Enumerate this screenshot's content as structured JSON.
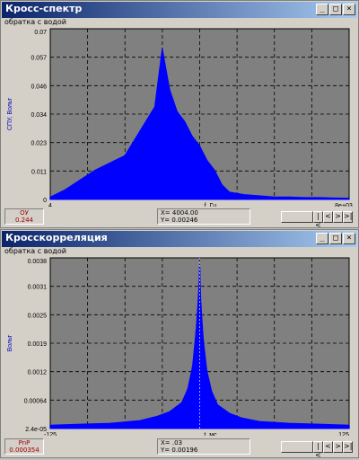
{
  "windows": [
    {
      "title": "Кросс-спектр",
      "subtitle": "обратка с водой",
      "footer_left": {
        "line1": "ОУ",
        "line2": "0.244"
      },
      "footer_mid": {
        "line1": "X= 4004.00",
        "line2": "Y= 0.00246"
      },
      "nav": {
        "first": "|<",
        "prev": "<",
        "next": ">",
        "last": ">|"
      }
    },
    {
      "title": "Кросскорреляция",
      "subtitle": "обратка с водой",
      "footer_left": {
        "line1": "PnP",
        "line2": "0.000354"
      },
      "footer_mid": {
        "line1": "X= .03",
        "line2": "Y= 0.00196"
      },
      "nav": {
        "first": "|<",
        "prev": "<",
        "next": ">",
        "last": ">|"
      }
    }
  ],
  "window_buttons": {
    "minimize": "_",
    "maximize": "□",
    "close": "×"
  },
  "chart_data": [
    {
      "type": "area",
      "title": "Кросс-спектр",
      "xlabel": "f, Гц",
      "ylabel": "СПУ, Вольт",
      "x_tick_labels": [
        "4",
        "8e+03"
      ],
      "y_tick_labels": [
        "0",
        "0.011",
        "0.023",
        "0.034",
        "0.046",
        "0.057",
        "0.07"
      ],
      "xlim": [
        4,
        8000
      ],
      "ylim": [
        0,
        0.07
      ],
      "grid": true,
      "series_color": "#0000ff",
      "background": "#808080",
      "x": [
        4,
        400,
        800,
        1200,
        1600,
        2000,
        2400,
        2800,
        3000,
        3200,
        3400,
        3600,
        3800,
        4000,
        4200,
        4400,
        4600,
        4800,
        5200,
        5600,
        6000,
        6400,
        6800,
        7200,
        7600,
        8000
      ],
      "values": [
        0.001,
        0.004,
        0.008,
        0.012,
        0.015,
        0.018,
        0.028,
        0.038,
        0.062,
        0.045,
        0.036,
        0.032,
        0.026,
        0.022,
        0.016,
        0.012,
        0.006,
        0.003,
        0.002,
        0.0015,
        0.001,
        0.001,
        0.0008,
        0.0008,
        0.0006,
        0.0005
      ]
    },
    {
      "type": "area",
      "title": "Кросскорреляция",
      "xlabel": "t, мс",
      "ylabel": "Вольт",
      "x_tick_labels": [
        "-125",
        "125"
      ],
      "y_tick_labels": [
        "2.4e-05",
        "0.00064",
        "0.0012",
        "0.0019",
        "0.0025",
        "0.0031",
        "0.0038"
      ],
      "xlim": [
        -125,
        125
      ],
      "ylim": [
        2.4e-05,
        0.0038
      ],
      "grid": true,
      "series_color": "#0000ff",
      "background": "#808080",
      "x": [
        -125,
        -100,
        -75,
        -50,
        -35,
        -25,
        -15,
        -10,
        -6,
        -3,
        -1,
        0,
        1,
        3,
        6,
        10,
        15,
        25,
        35,
        50,
        75,
        100,
        125
      ],
      "values": [
        0.0001,
        0.00012,
        0.00014,
        0.0002,
        0.0003,
        0.0004,
        0.0006,
        0.0009,
        0.0014,
        0.0022,
        0.003,
        0.0036,
        0.0028,
        0.002,
        0.0013,
        0.00085,
        0.00055,
        0.00036,
        0.00026,
        0.00018,
        0.00014,
        0.00012,
        0.0001
      ]
    }
  ]
}
